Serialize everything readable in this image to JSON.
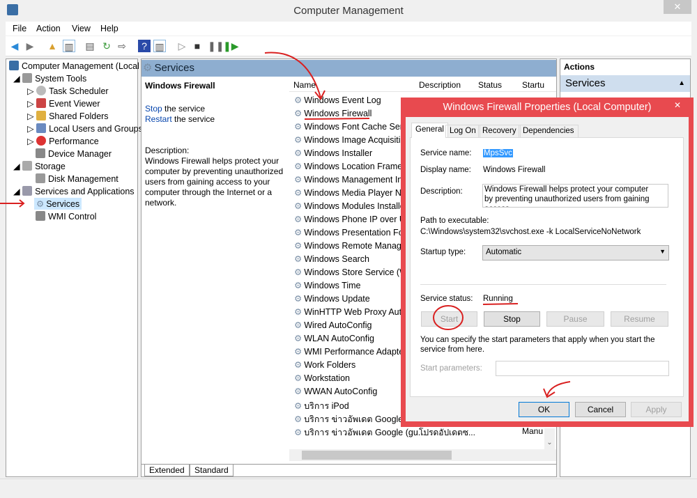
{
  "window": {
    "title": "Computer Management",
    "close": "✕"
  },
  "menu": [
    "File",
    "Action",
    "View",
    "Help"
  ],
  "tree": {
    "root": "Computer Management (Local",
    "items": [
      "System Tools",
      "Task Scheduler",
      "Event Viewer",
      "Shared Folders",
      "Local Users and Groups",
      "Performance",
      "Device Manager",
      "Storage",
      "Disk Management",
      "Services and Applications",
      "Services",
      "WMI Control"
    ]
  },
  "center": {
    "header": "Services",
    "selected_title": "Windows Firewall",
    "stop_link": "Stop",
    "stop_rest": " the service",
    "restart_link": "Restart",
    "restart_rest": " the service",
    "desc_label": "Description:",
    "desc": "Windows Firewall helps protect your computer by preventing unauthorized users from gaining access to your computer through the Internet or a network."
  },
  "columns": [
    "Name",
    "Description",
    "Status",
    "Startu"
  ],
  "services": [
    "Windows Event Log",
    "Windows Firewall",
    "Windows Font Cache Serv",
    "Windows Image Acquisitio",
    "Windows Installer",
    "Windows Location Framew",
    "Windows Management In",
    "Windows Media Player Ne",
    "Windows Modules Installe",
    "Windows Phone IP over U",
    "Windows Presentation Fou",
    "Windows Remote Manage",
    "Windows Search",
    "Windows Store Service (W",
    "Windows Time",
    "Windows Update",
    "WinHTTP Web Proxy Auto",
    "Wired AutoConfig",
    "WLAN AutoConfig",
    "WMI Performance Adapte",
    "Work Folders",
    "Workstation",
    "WWAN AutoConfig",
    "บริการ iPod",
    "บริการ ข่าวอัพเดต Google (gu",
    "บริการ ข่าวอัพเดต Google (gu..."
  ],
  "last_row": {
    "desc": "โปรดอัปเดตซ...",
    "startup": "Manu"
  },
  "tabs_bottom": [
    "Extended",
    "Standard"
  ],
  "actions": {
    "header": "Actions",
    "section": "Services"
  },
  "dialog": {
    "title": "Windows Firewall Properties (Local Computer)",
    "tabs": [
      "General",
      "Log On",
      "Recovery",
      "Dependencies"
    ],
    "service_name_label": "Service name:",
    "service_name": "MpsSvc",
    "display_name_label": "Display name:",
    "display_name": "Windows Firewall",
    "description_label": "Description:",
    "description": "Windows Firewall helps protect your computer by preventing unauthorized users from gaining access",
    "path_label": "Path to executable:",
    "path": "C:\\Windows\\system32\\svchost.exe -k LocalServiceNoNetwork",
    "startup_label": "Startup type:",
    "startup": "Automatic",
    "status_label": "Service status:",
    "status": "Running",
    "buttons": {
      "start": "Start",
      "stop": "Stop",
      "pause": "Pause",
      "resume": "Resume",
      "ok": "OK",
      "cancel": "Cancel",
      "apply": "Apply"
    },
    "hint": "You can specify the start parameters that apply when you start the service from here.",
    "params_label": "Start parameters:"
  }
}
